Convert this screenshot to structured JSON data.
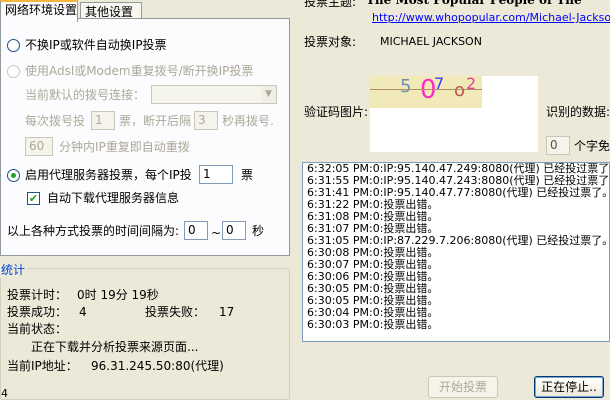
{
  "tabs": [
    {
      "label": "网络环境设置"
    },
    {
      "label": "其他设置"
    }
  ],
  "network": {
    "opt_no_change_ip": "不换IP或软件自动换IP投票",
    "opt_adsl": "使用Adsl或Modem重复拨号/断开换IP投票",
    "current_dial_label": "当前默认的拨号连接：",
    "current_dial_value": "",
    "dial_every_label": "每次拨号投",
    "dial_every_value": "1",
    "votes_disconnect_label": "票，断开后隔",
    "disconnect_value": "3",
    "seconds_redial_label": "秒再拨号.",
    "ip_repeat_value": "60",
    "ip_repeat_label": "分钟内IP重复即自动重拨",
    "opt_proxy": "启用代理服务器投票，每个IP投",
    "proxy_votes_value": "1",
    "proxy_votes_unit": "票",
    "auto_download_proxy": "自动下载代理服务器信息",
    "interval_label": "以上各种方式投票的时间间隔为:",
    "interval_min": "0",
    "interval_sep": "~",
    "interval_max": "0",
    "interval_unit": "秒"
  },
  "stats": {
    "title": "统计",
    "vote_time_label": "投票计时：",
    "vote_time_value": "0时 19分 19秒",
    "success_label": "投票成功：",
    "success_value": "4",
    "fail_label": "投票失败：",
    "fail_value": "17",
    "state_label": "当前状态：",
    "state_value": "正在下载并分析投票来源页面...",
    "ip_label": "当前IP地址：",
    "ip_value": "96.31.245.50:80(代理)",
    "bottom_count": "4"
  },
  "vote": {
    "topic_label": "投票主题:",
    "topic_value": "The Most Popular People of The",
    "topic_url": "http://www.whopopular.com/Michael-Jackson",
    "target_label": "投票对象:",
    "target_value": "MICHAEL JACKSON",
    "captcha_label": "验证码图片:",
    "captcha_text": [
      "5",
      "0",
      "7",
      "o",
      "2"
    ],
    "recognized_label": "识别的数据:",
    "char_count_value": "0",
    "char_count_label": "个字免"
  },
  "log": [
    "6:32:05 PM:0:IP:95.140.47.249:8080(代理) 已经投过票了。",
    "6:31:55 PM:0:IP:95.140.47.243:8080(代理) 已经投过票了。",
    "6:31:41 PM:0:IP:95.140.47.77:8080(代理) 已经投过票了。",
    "6:31:22 PM:0:投票出错。",
    "6:31:08 PM:0:投票出错。",
    "6:31:07 PM:0:投票出错。",
    "6:31:05 PM:0:IP:87.229.7.206:8080(代理) 已经投过票了。",
    "6:30:08 PM:0:投票出错。",
    "6:30:07 PM:0:投票出错。",
    "6:30:06 PM:0:投票出错。",
    "6:30:05 PM:0:投票出错。",
    "6:30:05 PM:0:投票出错。",
    "6:30:04 PM:0:投票出错。",
    "6:30:03 PM:0:投票出错。"
  ],
  "buttons": {
    "start": "开始投票",
    "stop": "正在停止.."
  },
  "colors": {
    "captcha_bg": "#f2e9b8",
    "captcha_5": "#6d8fb5",
    "captcha_0": "#ff2bc8",
    "captcha_7": "#3b3bff",
    "captcha_o": "#c05050",
    "captcha_2": "#e0409a"
  }
}
